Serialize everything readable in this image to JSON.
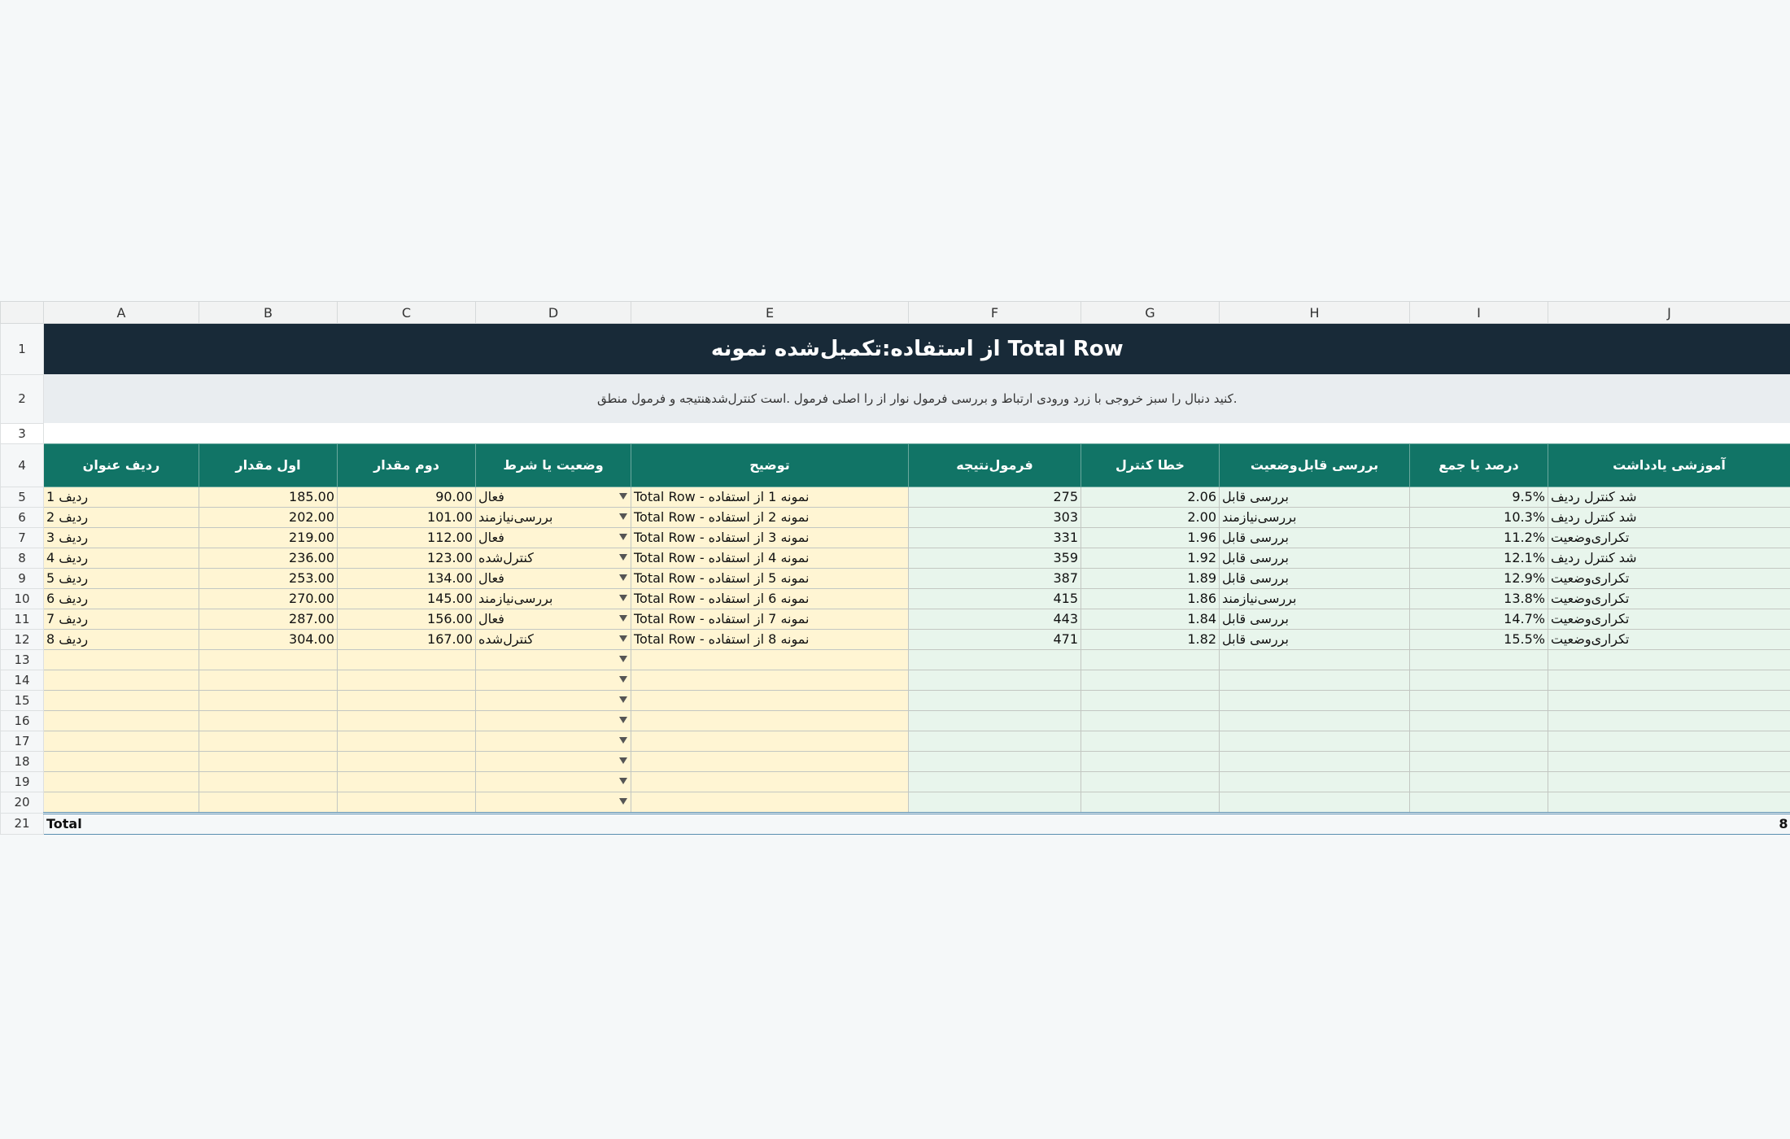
{
  "columns": [
    "A",
    "B",
    "C",
    "D",
    "E",
    "F",
    "G",
    "H",
    "I",
    "J"
  ],
  "row_numbers": [
    "1",
    "2",
    "3",
    "4",
    "5",
    "6",
    "7",
    "8",
    "9",
    "10",
    "11",
    "12",
    "13",
    "14",
    "15",
    "16",
    "17",
    "18",
    "19",
    "20",
    "21"
  ],
  "title": "Total Row از استفاده:تکمیل‌شده نمونه",
  "subtitle": ".کنید دنبال را سبز خروجی با زرد ورودی ارتباط و بررسی فرمول نوار از را اصلی فرمول .است کنترل‌شدهنتیجه و فرمول منطق",
  "headers": [
    "ردیف عنوان",
    "اول مقدار",
    "دوم مقدار",
    "وضعیت یا شرط",
    "توضیح",
    "فرمول‌نتیجه",
    "خطا کنترل",
    "بررسی قابل‌وضعیت",
    "درصد یا جمع",
    "آموزشی یادداشت"
  ],
  "rows": [
    {
      "a": "ردیف 1",
      "b": "185.00",
      "c": "90.00",
      "d": "فعال",
      "e": "Total Row - نمونه 1 از استفاده",
      "f": "275",
      "g": "2.06",
      "h": "بررسی قابل",
      "i": "9.5%",
      "j": "شد کنترل ردیف"
    },
    {
      "a": "ردیف 2",
      "b": "202.00",
      "c": "101.00",
      "d": "بررسی‌نیازمند",
      "e": "Total Row - نمونه 2 از استفاده",
      "f": "303",
      "g": "2.00",
      "h": "بررسی‌نیازمند",
      "i": "10.3%",
      "j": "شد کنترل ردیف"
    },
    {
      "a": "ردیف 3",
      "b": "219.00",
      "c": "112.00",
      "d": "فعال",
      "e": "Total Row - نمونه 3 از استفاده",
      "f": "331",
      "g": "1.96",
      "h": "بررسی قابل",
      "i": "11.2%",
      "j": "تکراری‌وضعیت"
    },
    {
      "a": "ردیف 4",
      "b": "236.00",
      "c": "123.00",
      "d": "کنترل‌شده",
      "e": "Total Row - نمونه 4 از استفاده",
      "f": "359",
      "g": "1.92",
      "h": "بررسی قابل",
      "i": "12.1%",
      "j": "شد کنترل ردیف"
    },
    {
      "a": "ردیف 5",
      "b": "253.00",
      "c": "134.00",
      "d": "فعال",
      "e": "Total Row - نمونه 5 از استفاده",
      "f": "387",
      "g": "1.89",
      "h": "بررسی قابل",
      "i": "12.9%",
      "j": "تکراری‌وضعیت"
    },
    {
      "a": "ردیف 6",
      "b": "270.00",
      "c": "145.00",
      "d": "بررسی‌نیازمند",
      "e": "Total Row - نمونه 6 از استفاده",
      "f": "415",
      "g": "1.86",
      "h": "بررسی‌نیازمند",
      "i": "13.8%",
      "j": "تکراری‌وضعیت"
    },
    {
      "a": "ردیف 7",
      "b": "287.00",
      "c": "156.00",
      "d": "فعال",
      "e": "Total Row - نمونه 7 از استفاده",
      "f": "443",
      "g": "1.84",
      "h": "بررسی قابل",
      "i": "14.7%",
      "j": "تکراری‌وضعیت"
    },
    {
      "a": "ردیف 8",
      "b": "304.00",
      "c": "167.00",
      "d": "کنترل‌شده",
      "e": "Total Row - نمونه 8 از استفاده",
      "f": "471",
      "g": "1.82",
      "h": "بررسی قابل",
      "i": "15.5%",
      "j": "تکراری‌وضعیت"
    }
  ],
  "empty_row_count": 8,
  "total": {
    "label": "Total",
    "value": "8"
  },
  "colors": {
    "title_bg": "#182a38",
    "header_bg": "#117466",
    "input_bg": "#fff5d3",
    "output_bg": "#e8f5ec",
    "subtitle_bg": "#e9edf0"
  }
}
